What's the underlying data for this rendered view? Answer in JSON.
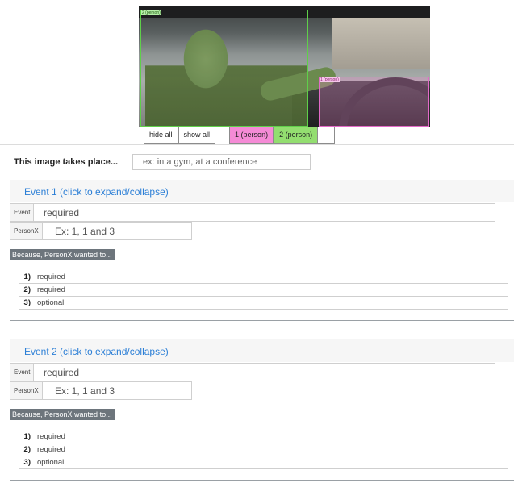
{
  "viewer": {
    "tags": {
      "person2": "2 (person)",
      "person1": "1 (person)"
    }
  },
  "controls": {
    "hide_all": "hide all",
    "show_all": "show all",
    "persons": [
      {
        "label": "1 (person)",
        "color": "#f58bd6"
      },
      {
        "label": "2 (person)",
        "color": "#93de70"
      }
    ]
  },
  "setting": {
    "label": "This image takes place...",
    "placeholder": "ex: in a gym, at a conference"
  },
  "events": [
    {
      "header": "Event 1 (click to expand/collapse)",
      "event_addon": "Event",
      "event_placeholder": "required",
      "personx_addon": "PersonX",
      "personx_placeholder": "Ex: 1, 1 and 3",
      "because": "Because, PersonX wanted to...",
      "reasons": [
        {
          "num": "1)",
          "placeholder": "required"
        },
        {
          "num": "2)",
          "placeholder": "required"
        },
        {
          "num": "3)",
          "placeholder": "optional"
        }
      ]
    },
    {
      "header": "Event 2 (click to expand/collapse)",
      "event_addon": "Event",
      "event_placeholder": "required",
      "personx_addon": "PersonX",
      "personx_placeholder": "Ex: 1, 1 and 3",
      "because": "Because, PersonX wanted to...",
      "reasons": [
        {
          "num": "1)",
          "placeholder": "required"
        },
        {
          "num": "2)",
          "placeholder": "required"
        },
        {
          "num": "3)",
          "placeholder": "optional"
        }
      ]
    }
  ],
  "colors": {
    "link": "#2c7fd6",
    "person1": "#f58bd6",
    "person2": "#93de70",
    "because_bg": "#6d757c"
  }
}
